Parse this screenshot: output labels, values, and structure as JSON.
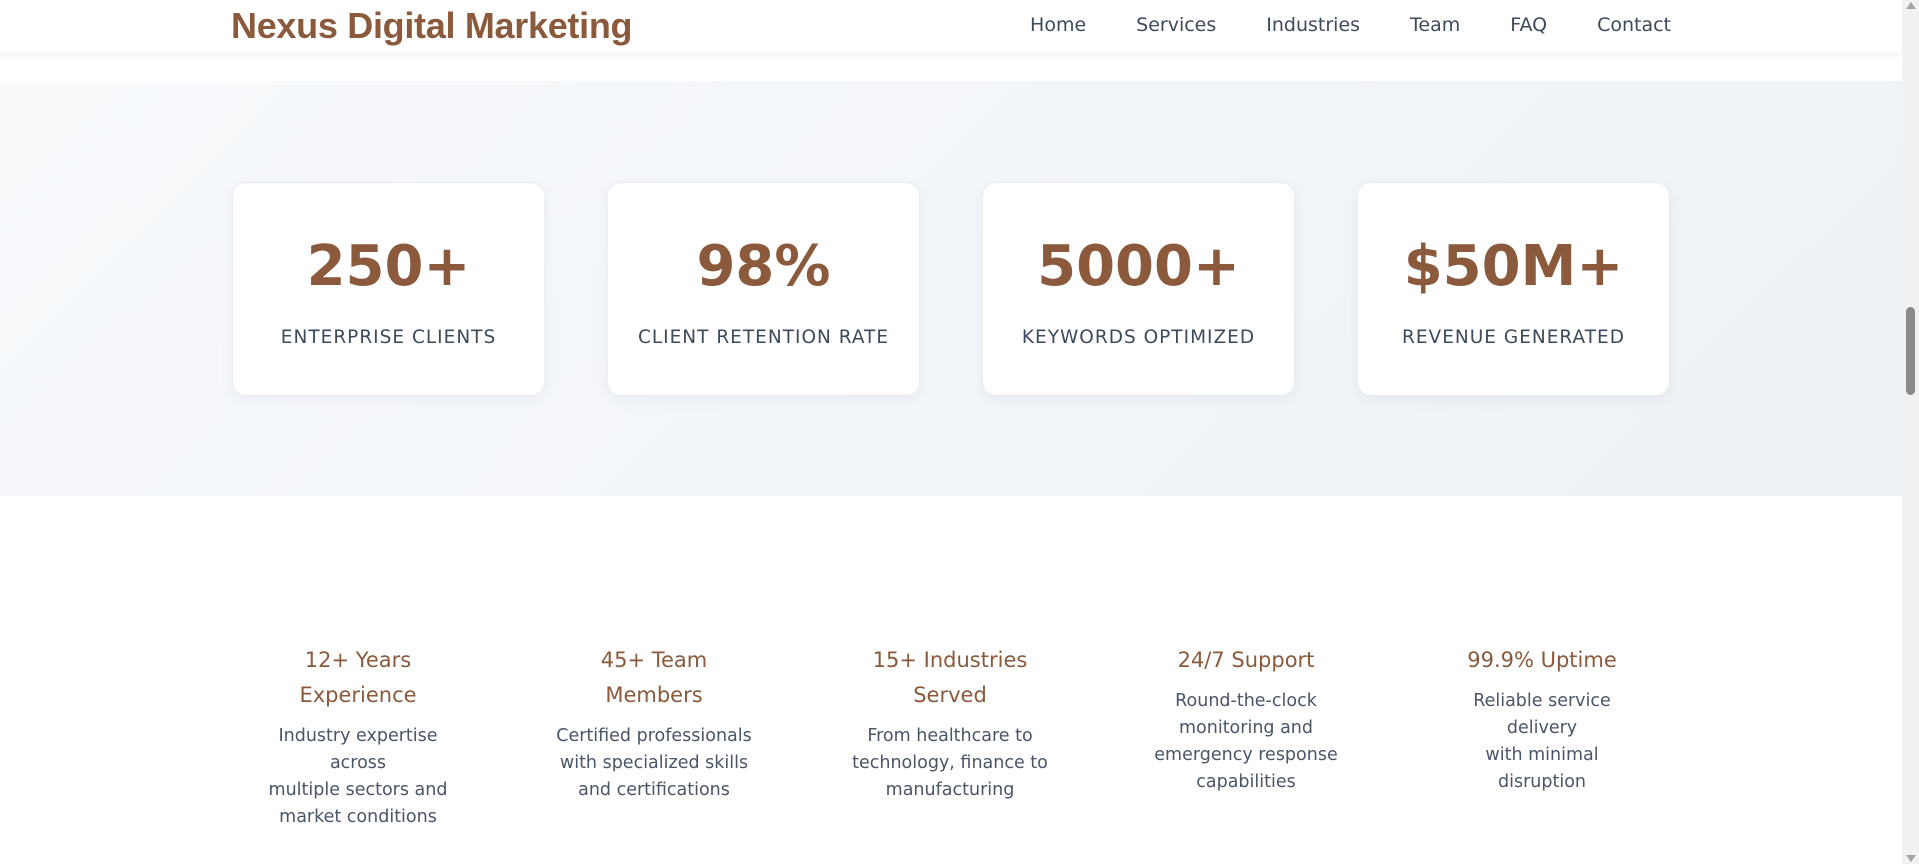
{
  "header": {
    "brand": "Nexus Digital Marketing",
    "nav": [
      "Home",
      "Services",
      "Industries",
      "Team",
      "FAQ",
      "Contact"
    ]
  },
  "stats": [
    {
      "value": "250+",
      "label": "ENTERPRISE CLIENTS"
    },
    {
      "value": "98%",
      "label": "CLIENT RETENTION RATE"
    },
    {
      "value": "5000+",
      "label": "KEYWORDS OPTIMIZED"
    },
    {
      "value": "$50M+",
      "label": "REVENUE GENERATED"
    }
  ],
  "features": [
    {
      "title_line1": "12+ Years",
      "title_line2": "Experience",
      "desc_lines": [
        "Industry expertise across",
        "multiple sectors and",
        "market conditions"
      ]
    },
    {
      "title_line1": "45+ Team",
      "title_line2": "Members",
      "desc_lines": [
        "Certified professionals",
        "with specialized skills",
        "and certifications"
      ]
    },
    {
      "title_line1": "15+ Industries",
      "title_line2": "Served",
      "desc_lines": [
        "From healthcare to",
        "technology, finance to",
        "manufacturing"
      ]
    },
    {
      "title_line1": "24/7 Support",
      "title_line2": "",
      "desc_lines": [
        "Round-the-clock",
        "monitoring and",
        "emergency response",
        "capabilities"
      ]
    },
    {
      "title_line1": "99.9% Uptime",
      "title_line2": "",
      "desc_lines": [
        "Reliable service delivery",
        "with minimal disruption"
      ]
    }
  ],
  "colors": {
    "brand": "#8b5a3c",
    "nav_text": "#3d4a5c",
    "band_bg": "#f2f5f9"
  }
}
